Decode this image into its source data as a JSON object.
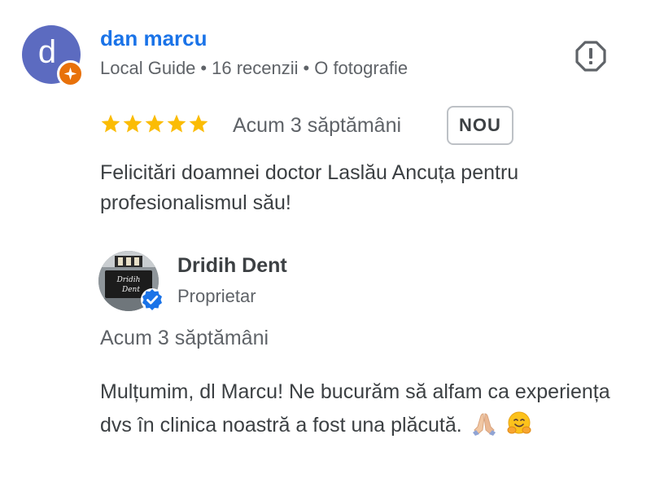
{
  "review": {
    "reviewer": {
      "initial": "d",
      "name": "dan marcu",
      "guide_label": "Local Guide",
      "separator": "•",
      "reviews_count": "16 recenzii",
      "photos_count": "O fotografie",
      "avatar_color": "#5c6bc0",
      "badge_color": "#e8710a",
      "badge_icon": "guide-star-icon"
    },
    "rating": 5,
    "rating_max": 5,
    "star_color": "#fbbc04",
    "time": "Acum 3 săptămâni",
    "new_badge": "NOU",
    "text": "Felicitări doamnei doctor Laslău Ancuța pentru profesionalismul său!",
    "report_icon": "report-icon"
  },
  "owner_response": {
    "name": "Dridih Dent",
    "role": "Proprietar",
    "avatar_sign_text": "Dridih Dent",
    "verified_icon": "verified-check-icon",
    "verified_color": "#1a73e8",
    "time": "Acum 3 săptămâni",
    "text": "Mulțumim, dl Marcu! Ne bucurăm să alfam ca experiența dvs în clinica noastră a fost una plăcută.",
    "emojis": [
      "folded-hands-emoji",
      "hugging-face-emoji"
    ]
  },
  "colors": {
    "link": "#1a73e8",
    "text": "#3c4043",
    "secondary_text": "#5f6368"
  }
}
